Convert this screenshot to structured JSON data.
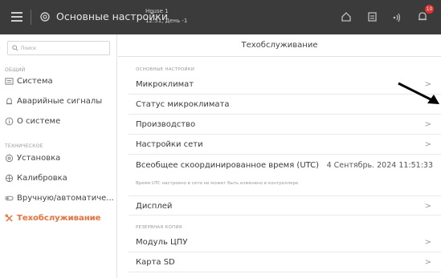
{
  "topbar": {
    "app_title": "Основные настройки",
    "house_name": "House 1",
    "house_status": "12:51, День -1",
    "badge_count": "10"
  },
  "sidebar": {
    "search_placeholder": "Поиск",
    "general_label": "ОБЩИЙ",
    "items_general": [
      {
        "label": "Система",
        "icon": "system-icon"
      },
      {
        "label": "Аварийные сигналы",
        "icon": "alarm-bell-icon"
      },
      {
        "label": "О системе",
        "icon": "info-icon"
      }
    ],
    "technical_label": "ТЕХНИЧЕСКОЕ",
    "items_technical": [
      {
        "label": "Установка",
        "icon": "settings-icon"
      },
      {
        "label": "Калибровка",
        "icon": "calibration-icon"
      },
      {
        "label": "Вручную/автоматиче...",
        "icon": "toggle-icon"
      },
      {
        "label": "Техобслуживание",
        "icon": "wrench-icon",
        "active": true
      }
    ],
    "accent_color": "#ef6f3a"
  },
  "main": {
    "title": "Техобслуживание",
    "group_basic": "ОСНОВНЫЕ НАСТРОЙКИ",
    "rows_basic": [
      {
        "label": "Микроклимат",
        "chevron": ">"
      },
      {
        "label": "Статус микроклимата",
        "chevron": ""
      },
      {
        "label": "Производство",
        "chevron": ">"
      },
      {
        "label": "Настройки сети",
        "chevron": ">"
      },
      {
        "label": "Всеобщее скоординированное время (UTC)",
        "value": "4 Сентябрь. 2024 11:51:33"
      }
    ],
    "utc_note": "Время UTC настроено в сети не может быть изменено в контроллере",
    "row_display": {
      "label": "Дисплей",
      "chevron": ">"
    },
    "group_backup": "РЕЗЕРВНАЯ КОПИЯ",
    "rows_backup": [
      {
        "label": "Модуль ЦПУ",
        "chevron": ">"
      },
      {
        "label": "Карта SD",
        "chevron": ">"
      }
    ]
  }
}
